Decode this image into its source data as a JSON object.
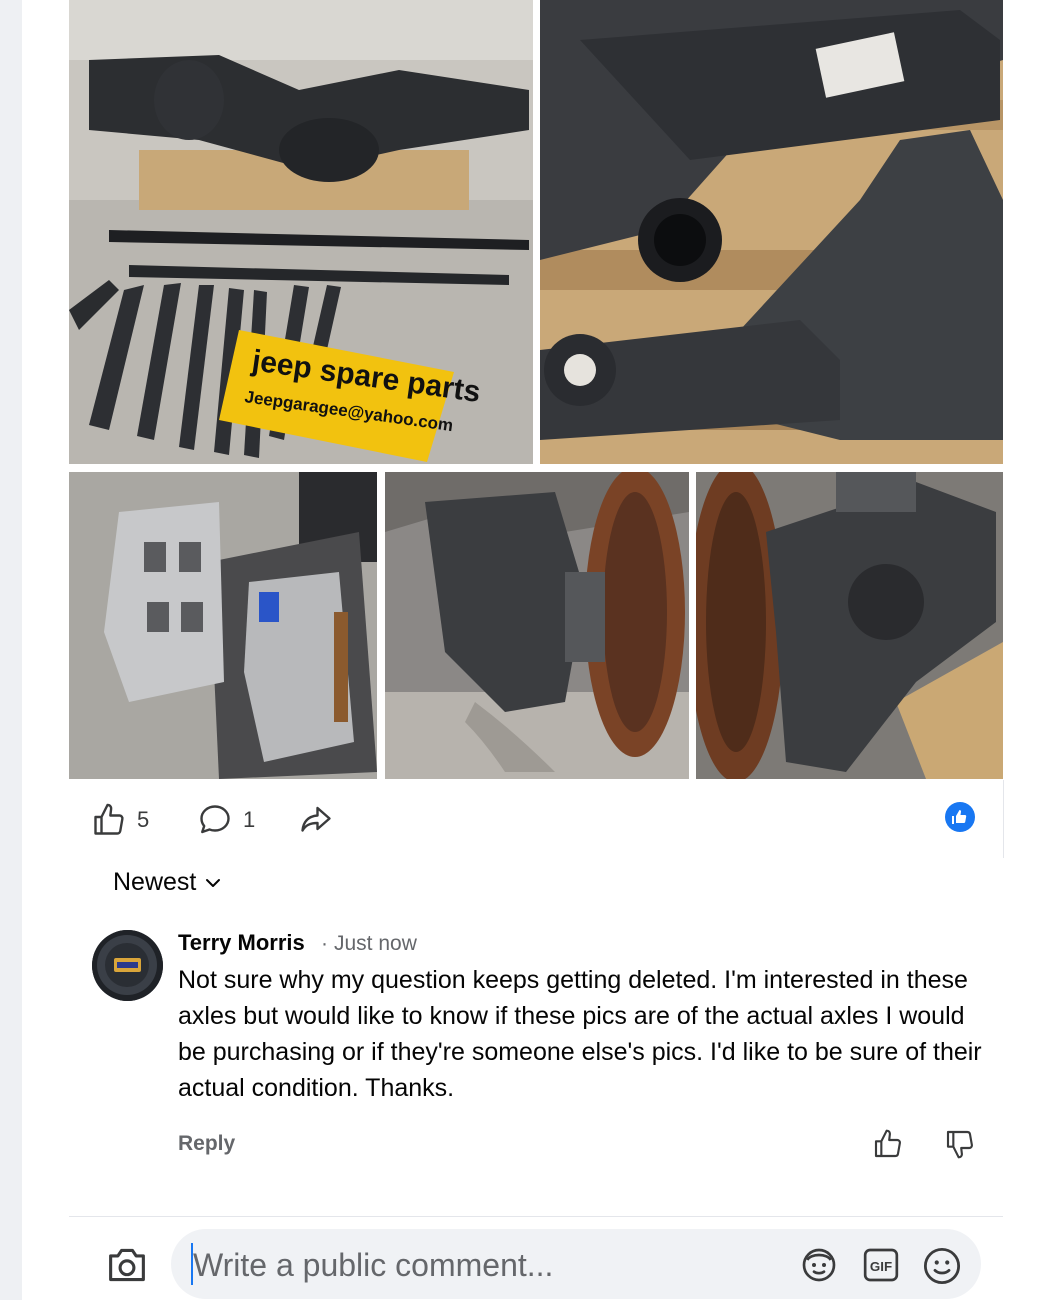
{
  "post": {
    "sign_text": [
      "jeep spare parts",
      "Jeepgaragee@yahoo.com"
    ],
    "reactions": {
      "like_count": "5",
      "comment_count": "1"
    }
  },
  "comments_section": {
    "sort_label": "Newest",
    "comments": [
      {
        "author": "Terry Morris",
        "separator": "·",
        "time": "Just now",
        "text": "Not sure why my question keeps getting deleted. I'm interested in these axles but would like to know if these pics are of the actual axles I would be purchasing or if they're someone else's pics. I'd like to be sure of their actual condition. Thanks.",
        "reply_label": "Reply"
      }
    ]
  },
  "composer": {
    "placeholder": "Write a public comment..."
  },
  "colors": {
    "accent": "#1877f2",
    "secondary_text": "#65676b",
    "sign_yellow": "#f2c20f"
  },
  "icons": [
    "thumbs-up-icon",
    "comment-bubble-icon",
    "share-arrow-icon",
    "like-reaction-badge-icon",
    "chevron-down-icon",
    "camera-icon",
    "avatar-sticker-icon",
    "gif-icon",
    "emoji-icon",
    "thumbs-down-icon"
  ]
}
